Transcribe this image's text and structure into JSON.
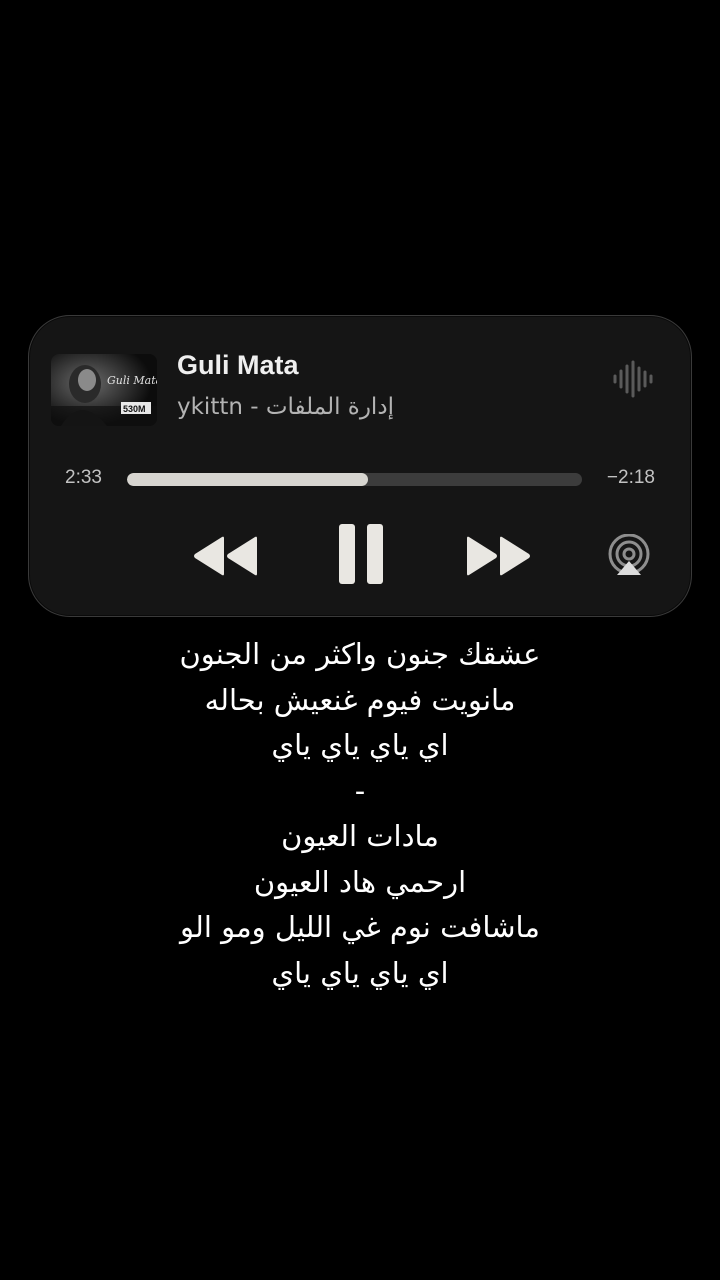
{
  "now_playing": {
    "title": "Guli Mata",
    "artist": "ykittn - إدارة الملفات",
    "artwork_text": "Guli Mata",
    "artwork_badge": "530M",
    "elapsed": "2:33",
    "remaining": "−2:18",
    "progress": 0.53,
    "icons": {
      "waveform": "waveform-icon",
      "rewind": "rewind-icon",
      "pause": "pause-icon",
      "forward": "fast-forward-icon",
      "airplay": "airplay-icon"
    },
    "colors": {
      "card_bg": "#151515",
      "progress_fill": "#d7d5d0",
      "progress_track": "#3c3c3c",
      "controls": "#e9e7e2"
    }
  },
  "lyrics": [
    "عشقك جنون واكثر من الجنون",
    "مانويت فيوم غنعيش بحاله",
    "اي ياي ياي ياي",
    "-",
    "مادات العيون",
    "ارحمي هاد العيون",
    "ماشافت نوم غي الليل ومو الو",
    "اي ياي ياي ياي"
  ]
}
